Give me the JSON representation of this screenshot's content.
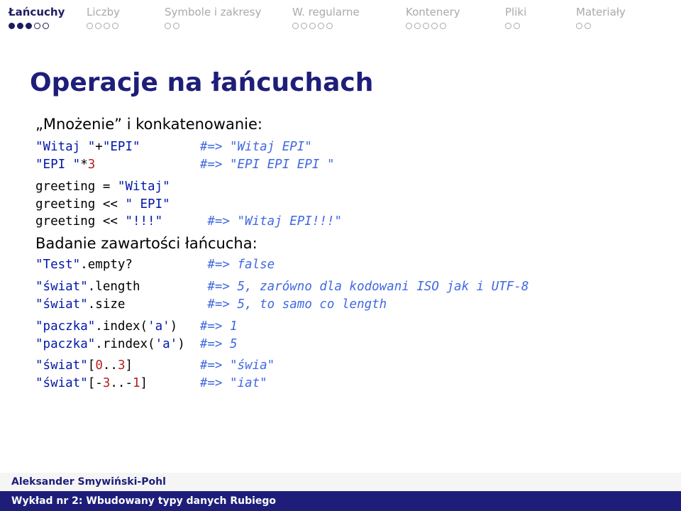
{
  "nav": {
    "items": [
      {
        "label": "Łańcuchy",
        "dots": 5,
        "active": true,
        "filled": 3
      },
      {
        "label": "Liczby",
        "dots": 4,
        "active": false,
        "filled": 0
      },
      {
        "label": "Symbole i zakresy",
        "dots": 2,
        "active": false,
        "filled": 0
      },
      {
        "label": "W. regularne",
        "dots": 5,
        "active": false,
        "filled": 0
      },
      {
        "label": "Kontenery",
        "dots": 5,
        "active": false,
        "filled": 0
      },
      {
        "label": "Pliki",
        "dots": 2,
        "active": false,
        "filled": 0
      },
      {
        "label": "Materiały",
        "dots": 2,
        "active": false,
        "filled": 0
      }
    ]
  },
  "title": "Operacje na łańcuchach",
  "subtitle1": "„Mnożenie” i konkatenowanie:",
  "code": {
    "l1a": "\"Witaj \"",
    "l1b": "+",
    "l1c": "\"EPI\"",
    "l1r": "#=> \"Witaj EPI\"",
    "l2a": "\"EPI \"",
    "l2b": "*",
    "l2c": "3",
    "l2r": "#=> \"EPI EPI EPI \"",
    "l3": "greeting = ",
    "l3s": "\"Witaj\"",
    "l4a": "greeting << ",
    "l4s": "\" EPI\"",
    "l5a": "greeting << ",
    "l5s": "\"!!!\"",
    "l5r": "#=> \"Witaj EPI!!!\"",
    "sec2": "Badanie zawartości łańcucha:",
    "l6a": "\"Test\"",
    "l6b": ".empty?",
    "l6r": "#=> false",
    "l7a": "\"świat\"",
    "l7b": ".length",
    "l7r": "#=> 5, zarówno dla kodowani ISO jak i UTF-8",
    "l8a": "\"świat\"",
    "l8b": ".size",
    "l8r": "#=> 5, to samo co length",
    "l9a": "\"paczka\"",
    "l9b": ".index(",
    "l9c": "'a'",
    "l9d": ")",
    "l9r": "#=> 1",
    "l10a": "\"paczka\"",
    "l10b": ".rindex(",
    "l10c": "'a'",
    "l10d": ")",
    "l10r": "#=> 5",
    "l11a": "\"świat\"",
    "l11b": "[",
    "l11c": "0",
    "l11d": "..",
    "l11e": "3",
    "l11f": "]",
    "l11r": "#=> \"świa\"",
    "l12a": "\"świat\"",
    "l12b": "[-",
    "l12c": "3",
    "l12d": "..-",
    "l12e": "1",
    "l12f": "]",
    "l12r": "#=> \"iat\""
  },
  "footer": {
    "author": "Aleksander Smywiński-Pohl",
    "lecture": "Wykład nr 2: Wbudowany typy danych Rubiego"
  }
}
